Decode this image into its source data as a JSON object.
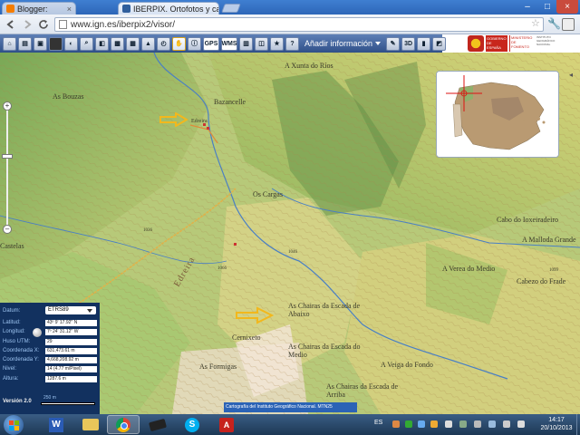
{
  "browser": {
    "tabs": [
      {
        "label": "Blogger:",
        "close": "×"
      },
      {
        "label": "IBERPIX. Ortofotos y carto",
        "close": "×"
      }
    ],
    "url": "www.ign.es/iberpix2/visor/",
    "window_controls": {
      "minimize": "–",
      "maximize": "□",
      "close": "×"
    }
  },
  "toolbar": {
    "gps_label": "GPS",
    "wms_label": "WMS",
    "add_info_label": "Añadir información",
    "icons": [
      "home-icon",
      "print-icon",
      "save-icon",
      "globe-icon",
      "measure-icon",
      "search-icon",
      "layers-icon",
      "photo-icon",
      "map-icon",
      "terrain-icon",
      "history-icon",
      "hand-icon",
      "info-icon",
      "gps-icon",
      "wms-icon",
      "table-icon",
      "ruler-icon",
      "star-icon",
      "help-icon",
      "chart-icon"
    ],
    "logos": {
      "gov_text": "GOBIERNO DE ESPAÑA",
      "ministry_text": "MINISTERIO DE FOMENTO",
      "ign_text": "INSTITUTO GEOGRÁFICO NACIONAL"
    }
  },
  "map": {
    "place_labels": [
      {
        "text": "A Xunta do Ríos"
      },
      {
        "text": "As Bouzas"
      },
      {
        "text": "Bazancelle"
      },
      {
        "text": "Edreira"
      },
      {
        "text": "Os Cargas"
      },
      {
        "text": "Cabo do Ioxeiradeiro"
      },
      {
        "text": "A Malloda Grande"
      },
      {
        "text": "A Verea do Medio"
      },
      {
        "text": "Cabezo do Frade"
      },
      {
        "text": "As Chairas da Escada de Abaixo"
      },
      {
        "text": "As Chairas da Escada do Medio"
      },
      {
        "text": "A Veiga do Fondo"
      },
      {
        "text": "As Chairas da Escada de Arriba"
      },
      {
        "text": "Cernixeto"
      },
      {
        "text": "As Formigas"
      },
      {
        "text": "Castelas"
      }
    ],
    "road_label": "Edreira",
    "spot_heights": [
      "1046",
      "1066",
      "1099",
      "1036"
    ],
    "zoom": {
      "in": "+",
      "out": "–"
    }
  },
  "info_panel": {
    "datum_label": "Datum:",
    "datum_value": "ETRS89",
    "latitud_label": "Latitud:",
    "latitud_value": "43º 9' 17.92'' N",
    "longitud_label": "Longitud:",
    "longitud_value": "7º 24' 31.12'' W",
    "huso_label": "Huso UTM:",
    "huso_value": "29",
    "coord_x_label": "Coordenada X:",
    "coord_x_value": "631,473.61 m",
    "coord_y_label": "Coordenada Y:",
    "coord_y_value": "4,668,208.92 m",
    "nivel_label": "Nivel:",
    "nivel_value": "14 (4.77 m/Pixel)",
    "altura_label": "Altura:",
    "altura_value": "1287.6 m",
    "version": "Versión 2.0",
    "scale_label": "250 m"
  },
  "attribution": "Cartografía del Instituto Geográfico Nacional. MTN25",
  "taskbar": {
    "word_letter": "W",
    "skype_letter": "S",
    "pdf_letter": "A",
    "lang": "ES",
    "time": "14:17",
    "date": "20/10/2013"
  }
}
